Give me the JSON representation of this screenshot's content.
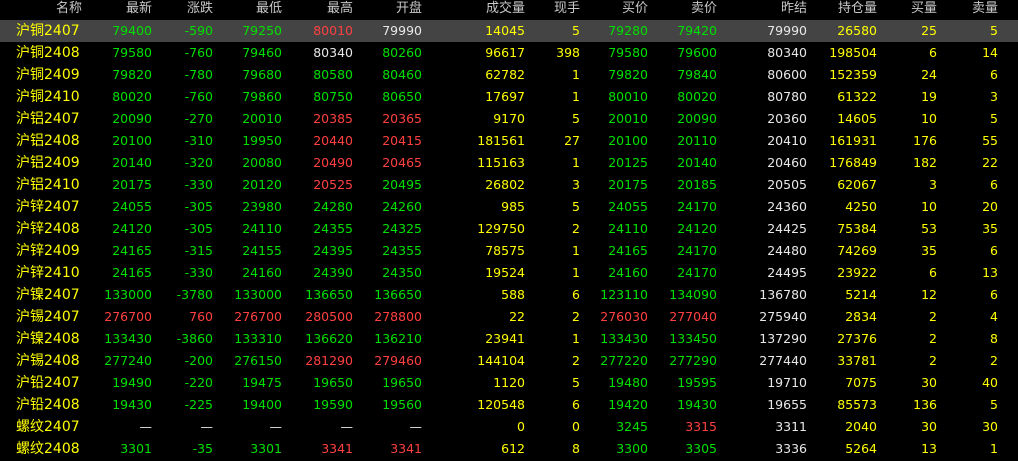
{
  "headers": [
    "名称",
    "最新",
    "涨跌",
    "最低",
    "最高",
    "开盘",
    "成交量",
    "现手",
    "买价",
    "卖价",
    "昨结",
    "持仓量",
    "买量",
    "卖量"
  ],
  "rows": [
    {
      "name": "沪铜2407",
      "last": "79400",
      "change": "-590",
      "low": "79250",
      "high": "80010",
      "open": "79990",
      "volume": "14045",
      "current": "5",
      "bid": "79280",
      "ask": "79420",
      "prev_settle": "79990",
      "open_interest": "26580",
      "bid_vol": "25",
      "ask_vol": "5"
    },
    {
      "name": "沪铜2408",
      "last": "79580",
      "change": "-760",
      "low": "79460",
      "high": "80340",
      "open": "80260",
      "volume": "96617",
      "current": "398",
      "bid": "79580",
      "ask": "79600",
      "prev_settle": "80340",
      "open_interest": "198504",
      "bid_vol": "6",
      "ask_vol": "14"
    },
    {
      "name": "沪铜2409",
      "last": "79820",
      "change": "-780",
      "low": "79680",
      "high": "80580",
      "open": "80460",
      "volume": "62782",
      "current": "1",
      "bid": "79820",
      "ask": "79840",
      "prev_settle": "80600",
      "open_interest": "152359",
      "bid_vol": "24",
      "ask_vol": "6"
    },
    {
      "name": "沪铜2410",
      "last": "80020",
      "change": "-760",
      "low": "79860",
      "high": "80750",
      "open": "80650",
      "volume": "17697",
      "current": "1",
      "bid": "80010",
      "ask": "80020",
      "prev_settle": "80780",
      "open_interest": "61322",
      "bid_vol": "19",
      "ask_vol": "3"
    },
    {
      "name": "沪铝2407",
      "last": "20090",
      "change": "-270",
      "low": "20010",
      "high": "20385",
      "open": "20365",
      "volume": "9170",
      "current": "5",
      "bid": "20010",
      "ask": "20090",
      "prev_settle": "20360",
      "open_interest": "14605",
      "bid_vol": "10",
      "ask_vol": "5"
    },
    {
      "name": "沪铝2408",
      "last": "20100",
      "change": "-310",
      "low": "19950",
      "high": "20440",
      "open": "20415",
      "volume": "181561",
      "current": "27",
      "bid": "20100",
      "ask": "20110",
      "prev_settle": "20410",
      "open_interest": "161931",
      "bid_vol": "176",
      "ask_vol": "55"
    },
    {
      "name": "沪铝2409",
      "last": "20140",
      "change": "-320",
      "low": "20080",
      "high": "20490",
      "open": "20465",
      "volume": "115163",
      "current": "1",
      "bid": "20125",
      "ask": "20140",
      "prev_settle": "20460",
      "open_interest": "176849",
      "bid_vol": "182",
      "ask_vol": "22"
    },
    {
      "name": "沪铝2410",
      "last": "20175",
      "change": "-330",
      "low": "20120",
      "high": "20525",
      "open": "20495",
      "volume": "26802",
      "current": "3",
      "bid": "20175",
      "ask": "20185",
      "prev_settle": "20505",
      "open_interest": "62067",
      "bid_vol": "3",
      "ask_vol": "6"
    },
    {
      "name": "沪锌2407",
      "last": "24055",
      "change": "-305",
      "low": "23980",
      "high": "24280",
      "open": "24260",
      "volume": "985",
      "current": "5",
      "bid": "24055",
      "ask": "24170",
      "prev_settle": "24360",
      "open_interest": "4250",
      "bid_vol": "10",
      "ask_vol": "20"
    },
    {
      "name": "沪锌2408",
      "last": "24120",
      "change": "-305",
      "low": "24110",
      "high": "24355",
      "open": "24325",
      "volume": "129750",
      "current": "2",
      "bid": "24110",
      "ask": "24120",
      "prev_settle": "24425",
      "open_interest": "75384",
      "bid_vol": "53",
      "ask_vol": "35"
    },
    {
      "name": "沪锌2409",
      "last": "24165",
      "change": "-315",
      "low": "24155",
      "high": "24395",
      "open": "24355",
      "volume": "78575",
      "current": "1",
      "bid": "24165",
      "ask": "24170",
      "prev_settle": "24480",
      "open_interest": "74269",
      "bid_vol": "35",
      "ask_vol": "6"
    },
    {
      "name": "沪锌2410",
      "last": "24165",
      "change": "-330",
      "low": "24160",
      "high": "24390",
      "open": "24350",
      "volume": "19524",
      "current": "1",
      "bid": "24160",
      "ask": "24170",
      "prev_settle": "24495",
      "open_interest": "23922",
      "bid_vol": "6",
      "ask_vol": "13"
    },
    {
      "name": "沪镍2407",
      "last": "133000",
      "change": "-3780",
      "low": "133000",
      "high": "136650",
      "open": "136650",
      "volume": "588",
      "current": "6",
      "bid": "123110",
      "ask": "134090",
      "prev_settle": "136780",
      "open_interest": "5214",
      "bid_vol": "12",
      "ask_vol": "6"
    },
    {
      "name": "沪锡2407",
      "last": "276700",
      "change": "760",
      "low": "276700",
      "high": "280500",
      "open": "278800",
      "volume": "22",
      "current": "2",
      "bid": "276030",
      "ask": "277040",
      "prev_settle": "275940",
      "open_interest": "2834",
      "bid_vol": "2",
      "ask_vol": "4"
    },
    {
      "name": "沪镍2408",
      "last": "133430",
      "change": "-3860",
      "low": "133310",
      "high": "136620",
      "open": "136210",
      "volume": "23941",
      "current": "1",
      "bid": "133430",
      "ask": "133450",
      "prev_settle": "137290",
      "open_interest": "27376",
      "bid_vol": "2",
      "ask_vol": "8"
    },
    {
      "name": "沪锡2408",
      "last": "277240",
      "change": "-200",
      "low": "276150",
      "high": "281290",
      "open": "279460",
      "volume": "144104",
      "current": "2",
      "bid": "277220",
      "ask": "277290",
      "prev_settle": "277440",
      "open_interest": "33781",
      "bid_vol": "2",
      "ask_vol": "2"
    },
    {
      "name": "沪铅2407",
      "last": "19490",
      "change": "-220",
      "low": "19475",
      "high": "19650",
      "open": "19650",
      "volume": "1120",
      "current": "5",
      "bid": "19480",
      "ask": "19595",
      "prev_settle": "19710",
      "open_interest": "7075",
      "bid_vol": "30",
      "ask_vol": "40"
    },
    {
      "name": "沪铅2408",
      "last": "19430",
      "change": "-225",
      "low": "19400",
      "high": "19590",
      "open": "19560",
      "volume": "120548",
      "current": "6",
      "bid": "19420",
      "ask": "19430",
      "prev_settle": "19655",
      "open_interest": "85573",
      "bid_vol": "136",
      "ask_vol": "5"
    },
    {
      "name": "螺纹2407",
      "last": "—",
      "change": "—",
      "low": "—",
      "high": "—",
      "open": "—",
      "volume": "0",
      "current": "0",
      "bid": "3245",
      "ask": "3315",
      "prev_settle": "3311",
      "open_interest": "2040",
      "bid_vol": "30",
      "ask_vol": "30"
    },
    {
      "name": "螺纹2408",
      "last": "3301",
      "change": "-35",
      "low": "3301",
      "high": "3341",
      "open": "3341",
      "volume": "612",
      "current": "8",
      "bid": "3300",
      "ask": "3305",
      "prev_settle": "3336",
      "open_interest": "5264",
      "bid_vol": "13",
      "ask_vol": "1"
    }
  ],
  "colors": {
    "up": "#ff4040",
    "down": "#00e000",
    "flat": "#e8e8e8",
    "name": "#ffff00",
    "selected_row": "#444444"
  }
}
